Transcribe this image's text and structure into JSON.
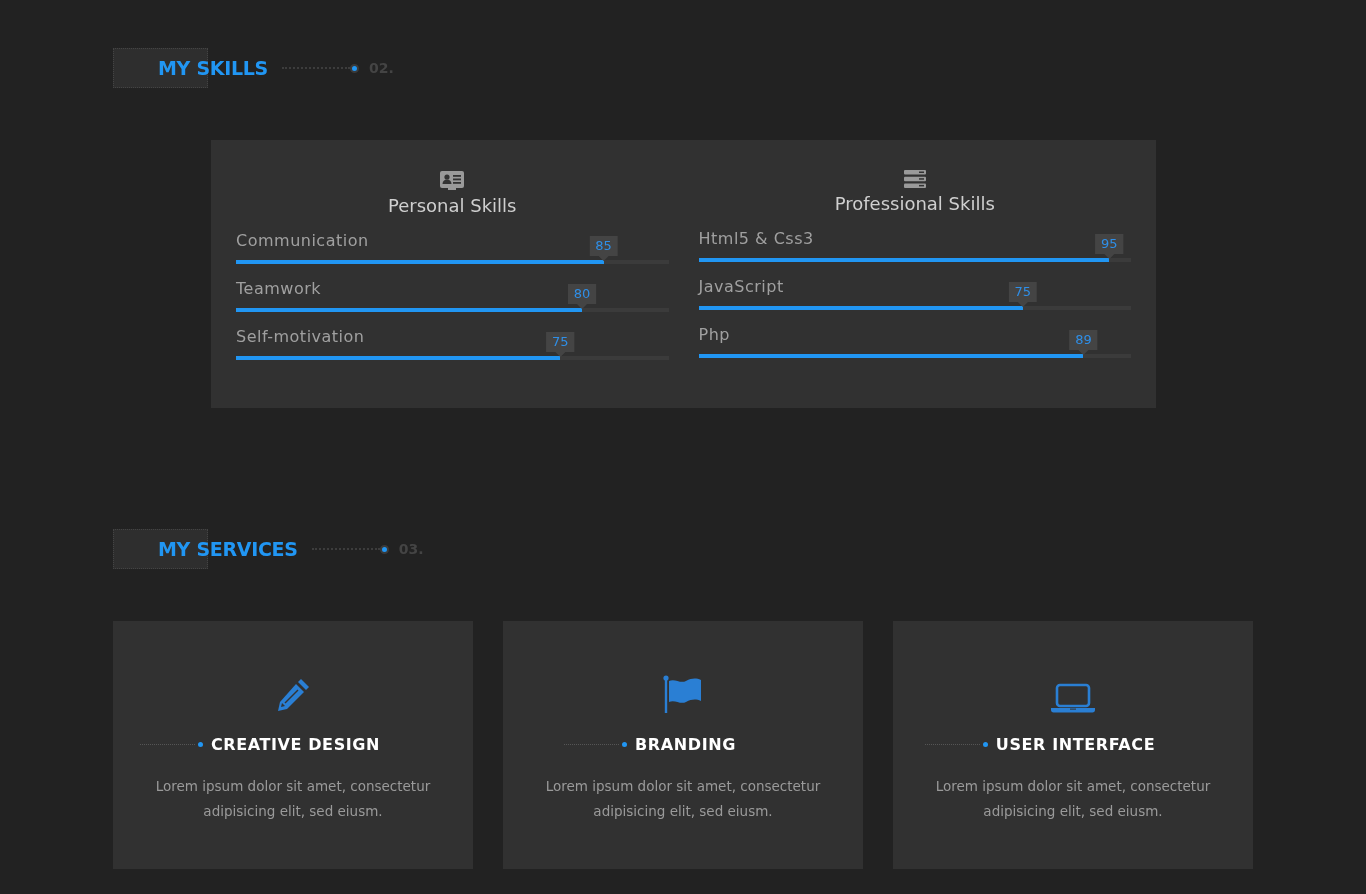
{
  "skills_section": {
    "title": "MY SKILLS",
    "number": "02.",
    "groups": [
      {
        "title": "Personal Skills",
        "skills": [
          {
            "name": "Communication",
            "value": "85",
            "level": 0.85
          },
          {
            "name": "Teamwork",
            "value": "80",
            "level": 0.8
          },
          {
            "name": "Self-motivation",
            "value": "75",
            "level": 0.75
          }
        ]
      },
      {
        "title": "Professional Skills",
        "skills": [
          {
            "name": "Html5 & Css3",
            "value": "95",
            "level": 0.95
          },
          {
            "name": "JavaScript",
            "value": "75",
            "level": 0.75
          },
          {
            "name": "Php",
            "value": "89",
            "level": 0.89
          }
        ]
      }
    ]
  },
  "services_section": {
    "title": "MY SERVICES",
    "number": "03.",
    "services": [
      {
        "title": "CREATIVE DESIGN",
        "text": "Lorem ipsum dolor sit amet, consectetur adipisicing elit, sed eiusm."
      },
      {
        "title": "BRANDING",
        "text": "Lorem ipsum dolor sit amet, consectetur adipisicing elit, sed eiusm."
      },
      {
        "title": "USER INTERFACE",
        "text": "Lorem ipsum dolor sit amet, consectetur adipisicing elit, sed eiusm."
      }
    ]
  }
}
